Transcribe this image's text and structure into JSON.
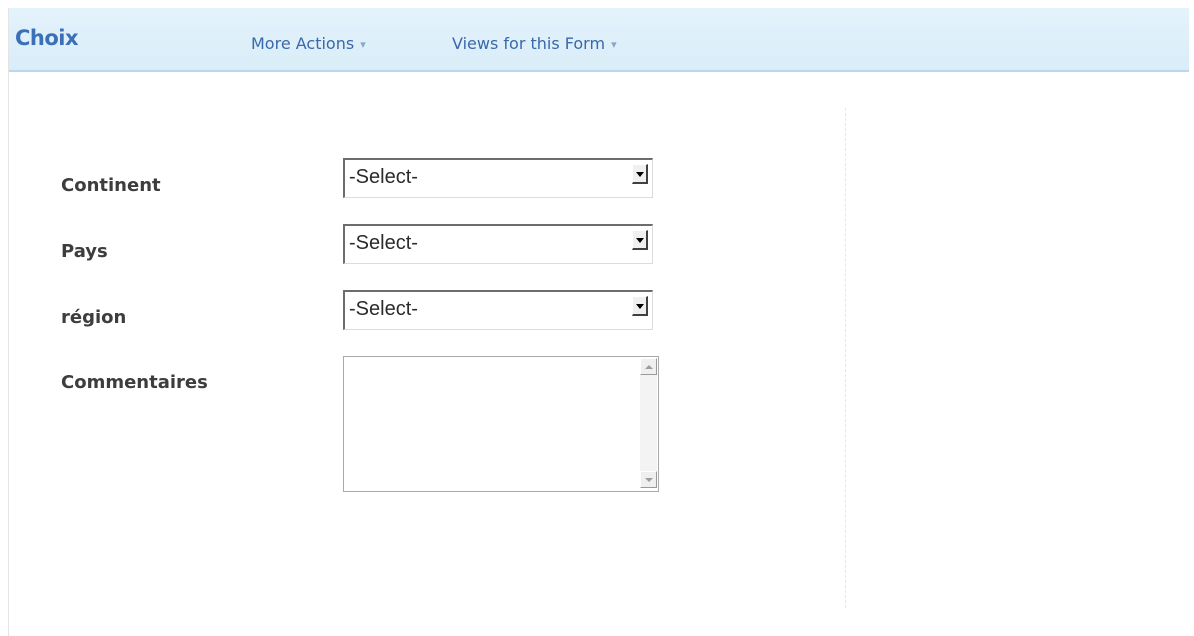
{
  "header": {
    "title": "Choix",
    "menus": [
      {
        "label": "More Actions"
      },
      {
        "label": "Views for this Form"
      }
    ],
    "caret_glyph": "▾"
  },
  "form": {
    "fields": [
      {
        "label": "Continent",
        "value": "-Select-",
        "type": "select"
      },
      {
        "label": "Pays",
        "value": "-Select-",
        "type": "select"
      },
      {
        "label": "région",
        "value": "-Select-",
        "type": "select"
      },
      {
        "label": "Commentaires",
        "value": "",
        "type": "textarea"
      }
    ]
  },
  "colors": {
    "header_background": "#dcedf8",
    "title": "#3b6fb8",
    "menu_link": "#3a68a8",
    "label": "#3d3d3d"
  }
}
